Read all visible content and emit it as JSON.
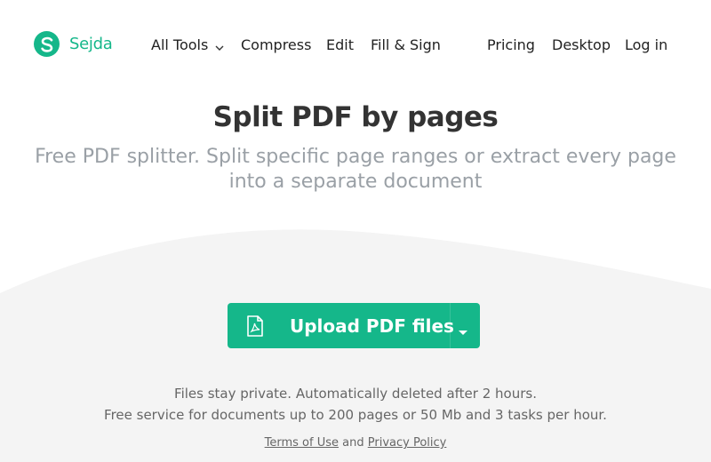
{
  "brand": {
    "name": "Sejda",
    "accent": "#15b78a"
  },
  "nav": {
    "items": [
      {
        "label": "All Tools",
        "has_dropdown": true
      },
      {
        "label": "Compress"
      },
      {
        "label": "Edit"
      },
      {
        "label": "Fill & Sign"
      },
      {
        "label": "Pricing"
      },
      {
        "label": "Desktop"
      },
      {
        "label": "Log in"
      }
    ]
  },
  "hero": {
    "title": "Split PDF by pages",
    "subtitle": "Free PDF splitter. Split specific page ranges or extract every page into a separate document"
  },
  "upload": {
    "label": "Upload PDF files",
    "icon": "pdf-file-icon",
    "caret_icon": "caret-down-icon"
  },
  "info": {
    "line1": "Files stay private. Automatically deleted after 2 hours.",
    "line2": "Free service for documents up to 200 pages or 50 Mb and 3 tasks per hour."
  },
  "legal": {
    "terms": "Terms of Use",
    "and": "and",
    "privacy": "Privacy Policy"
  }
}
